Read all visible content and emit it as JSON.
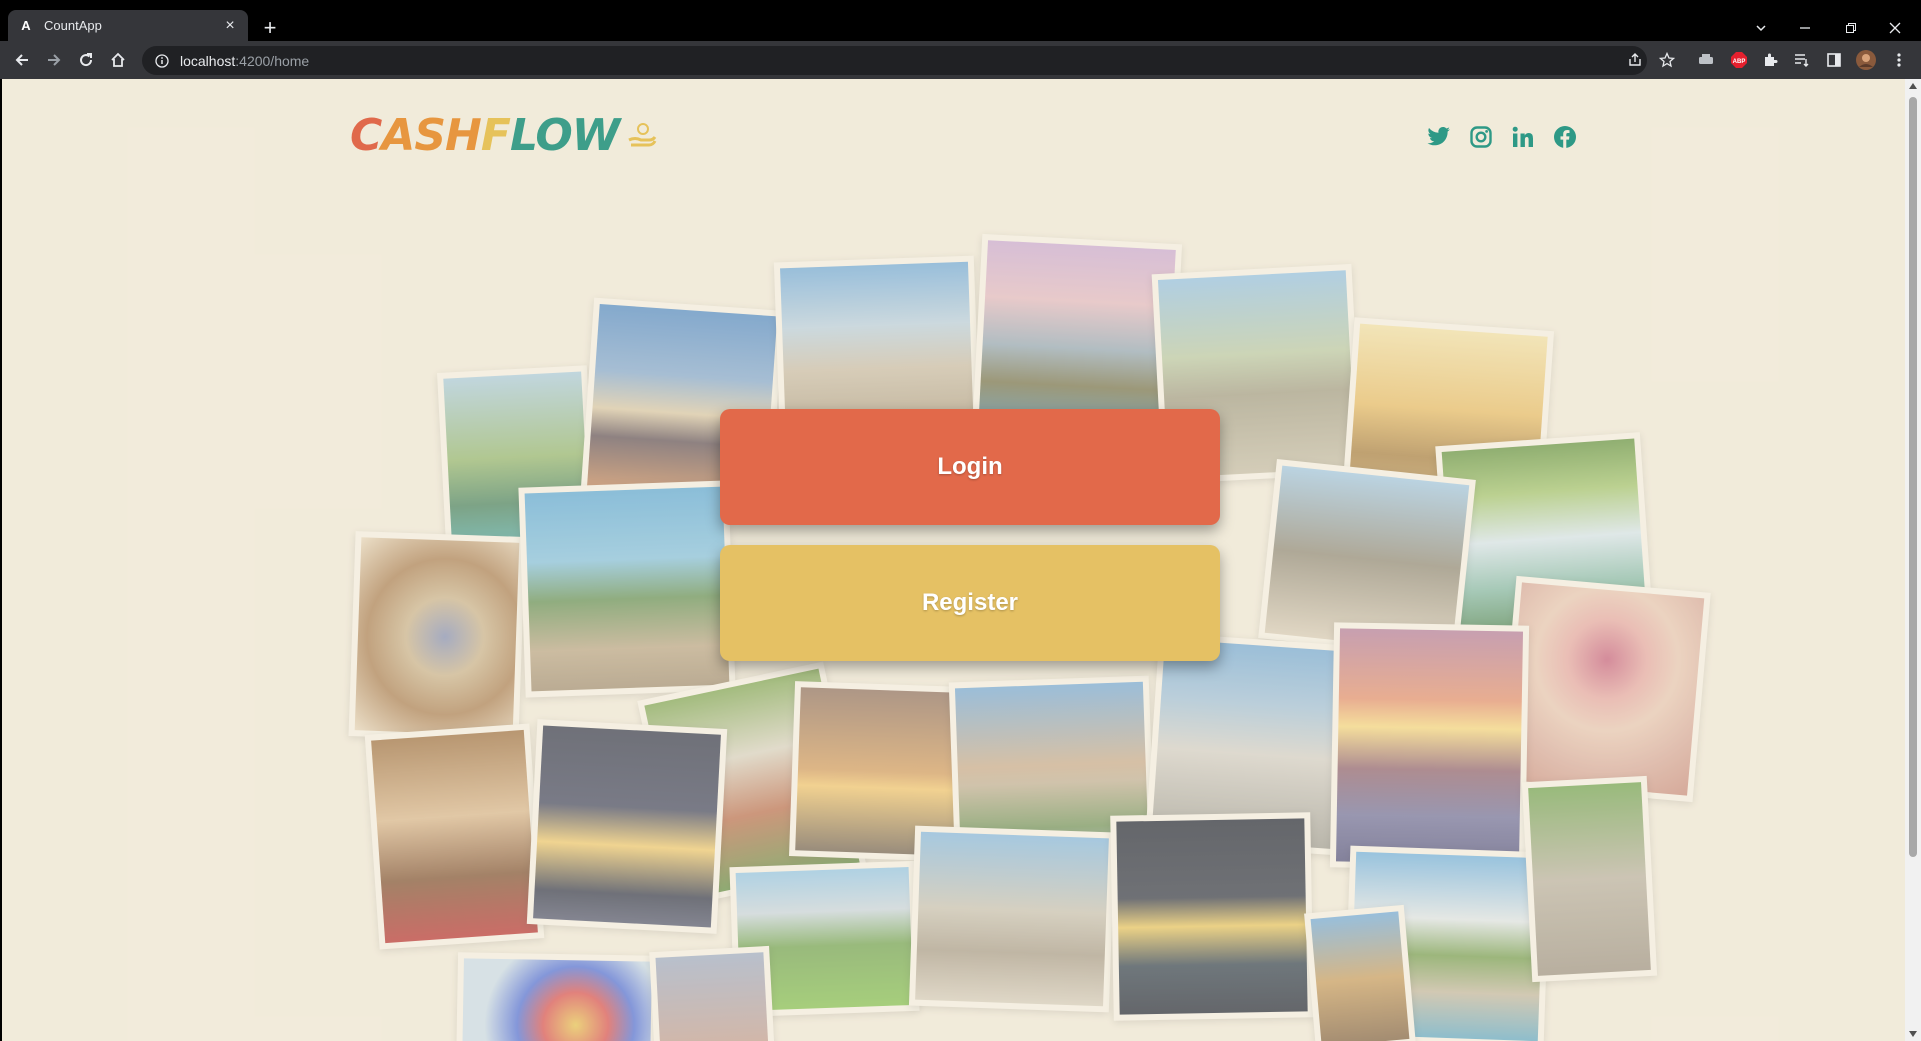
{
  "browser": {
    "tab_title": "CountApp",
    "tab_favicon": "A",
    "url_host": "localhost",
    "url_path": ":4200/home",
    "icons": [
      "back-icon",
      "forward-icon",
      "reload-icon",
      "home-icon",
      "share-icon",
      "star-icon",
      "extensions-icon",
      "menu-icon"
    ]
  },
  "header": {
    "logo": "CASHFLOW",
    "social": [
      "twitter-icon",
      "instagram-icon",
      "linkedin-icon",
      "facebook-icon"
    ],
    "social_color": "#2e9986"
  },
  "actions": {
    "login_label": "Login",
    "register_label": "Register"
  },
  "colors": {
    "background": "#f2ebdb",
    "login": "#e2694a",
    "register": "#e5c164"
  }
}
